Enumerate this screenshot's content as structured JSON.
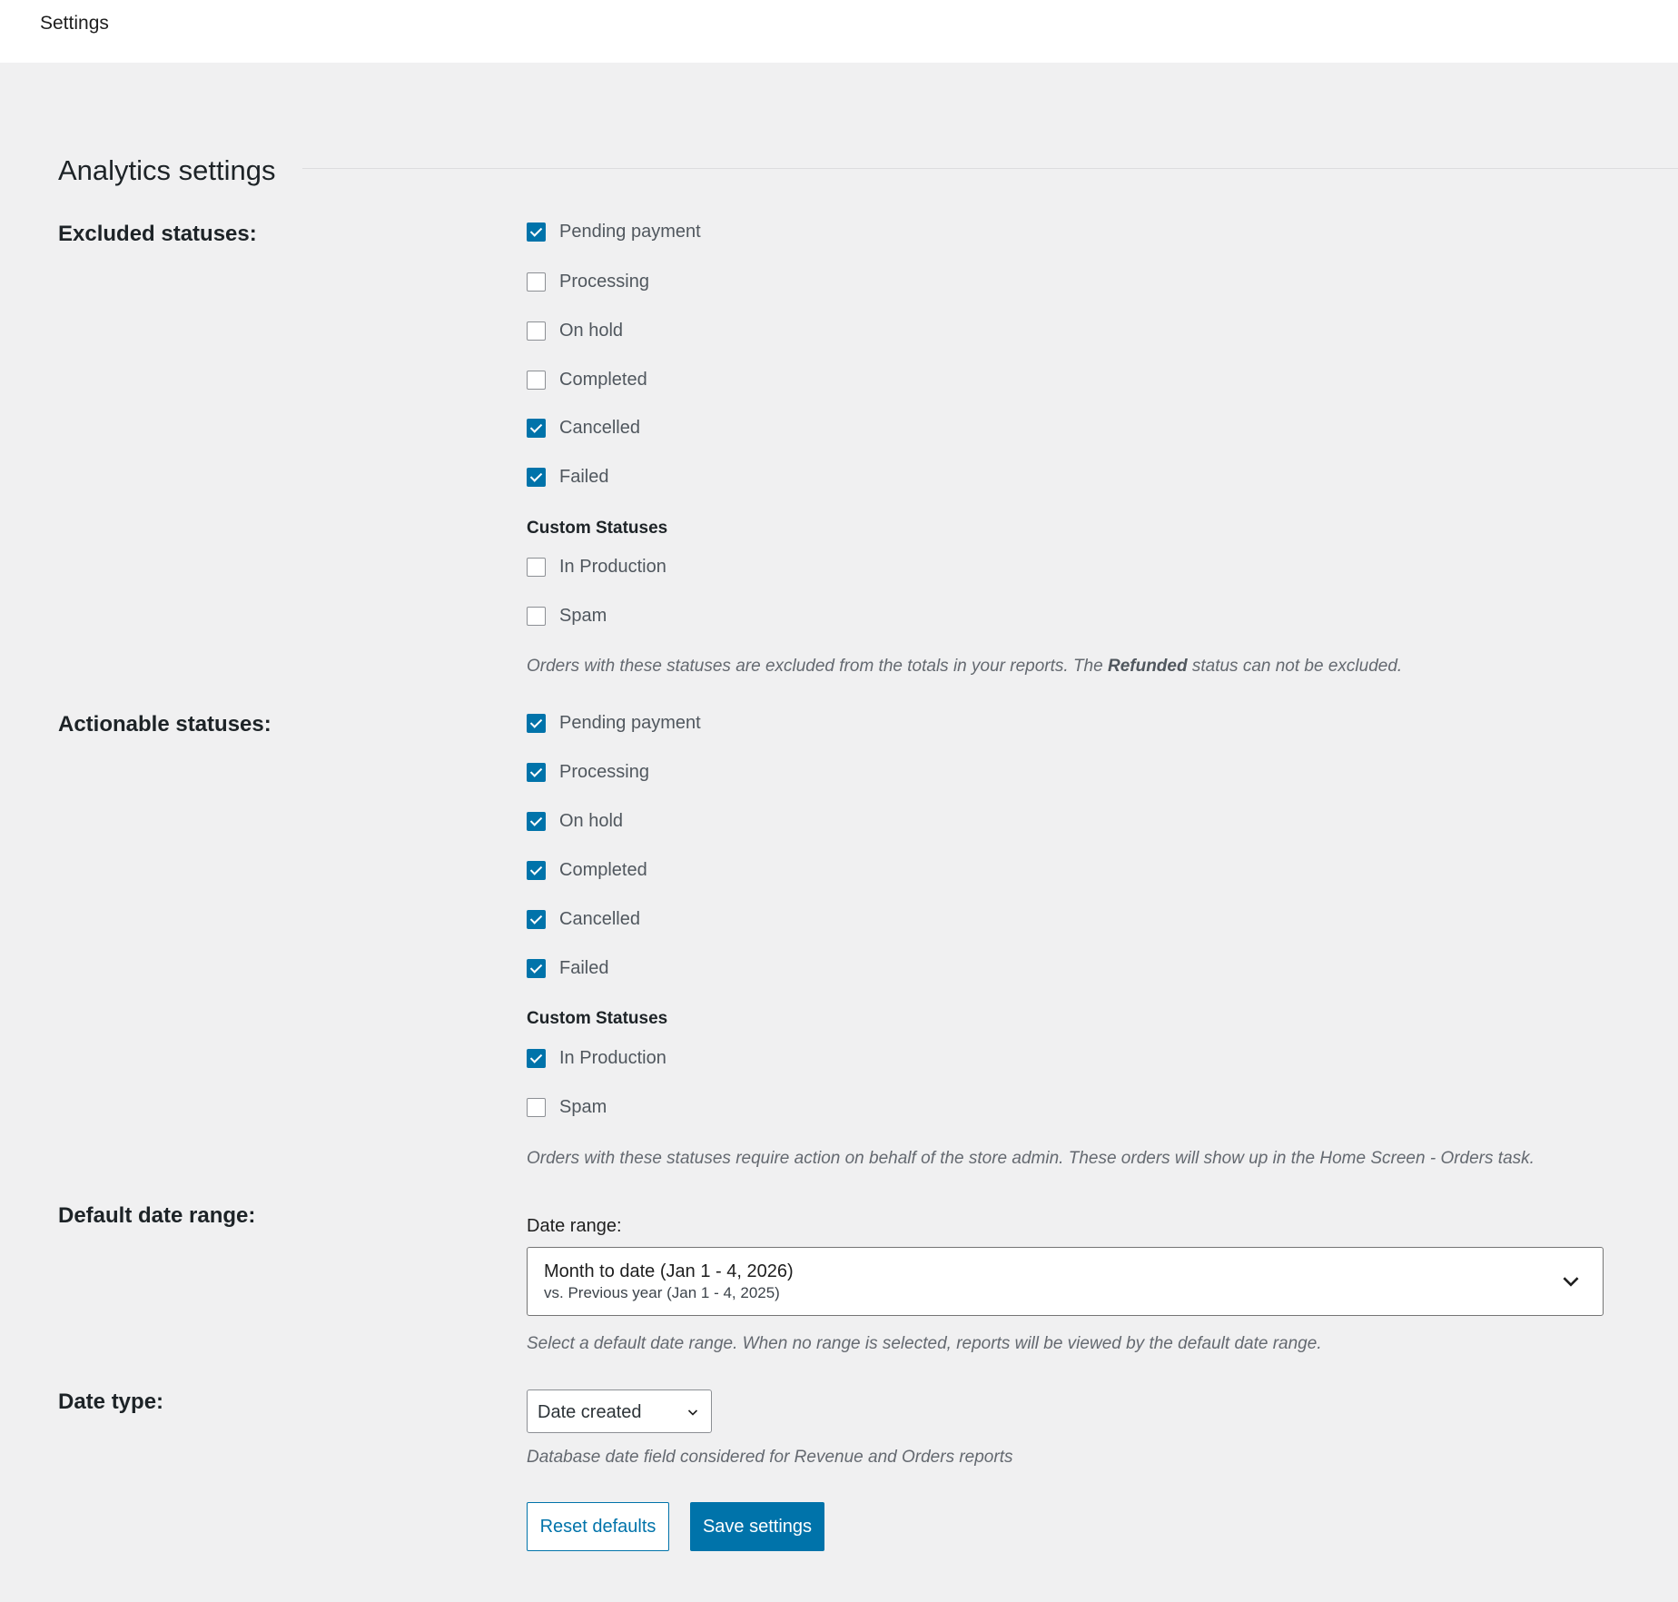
{
  "header": {
    "breadcrumb": "Settings"
  },
  "section": {
    "title": "Analytics settings"
  },
  "excluded": {
    "label": "Excluded statuses:",
    "statuses": [
      {
        "label": "Pending payment",
        "checked": true
      },
      {
        "label": "Processing",
        "checked": false
      },
      {
        "label": "On hold",
        "checked": false
      },
      {
        "label": "Completed",
        "checked": false
      },
      {
        "label": "Cancelled",
        "checked": true
      },
      {
        "label": "Failed",
        "checked": true
      }
    ],
    "custom_heading": "Custom Statuses",
    "custom_statuses": [
      {
        "label": "In Production",
        "checked": false
      },
      {
        "label": "Spam",
        "checked": false
      }
    ],
    "help_before": "Orders with these statuses are excluded from the totals in your reports. The ",
    "help_bold": "Refunded",
    "help_after": " status can not be excluded."
  },
  "actionable": {
    "label": "Actionable statuses:",
    "statuses": [
      {
        "label": "Pending payment",
        "checked": true
      },
      {
        "label": "Processing",
        "checked": true
      },
      {
        "label": "On hold",
        "checked": true
      },
      {
        "label": "Completed",
        "checked": true
      },
      {
        "label": "Cancelled",
        "checked": true
      },
      {
        "label": "Failed",
        "checked": true
      }
    ],
    "custom_heading": "Custom Statuses",
    "custom_statuses": [
      {
        "label": "In Production",
        "checked": true
      },
      {
        "label": "Spam",
        "checked": false
      }
    ],
    "help": "Orders with these statuses require action on behalf of the store admin. These orders will show up in the Home Screen - Orders task."
  },
  "default_date_range": {
    "label": "Default date range:",
    "field_label": "Date range:",
    "primary": "Month to date (Jan 1 - 4, 2026)",
    "secondary": "vs. Previous year (Jan 1 - 4, 2025)",
    "help": "Select a default date range. When no range is selected, reports will be viewed by the default date range."
  },
  "date_type": {
    "label": "Date type:",
    "selected": "Date created",
    "help": "Database date field considered for Revenue and Orders reports"
  },
  "actions": {
    "reset_label": "Reset defaults",
    "save_label": "Save settings"
  },
  "colors": {
    "accent": "#0073aa",
    "background": "#f0f0f1"
  }
}
